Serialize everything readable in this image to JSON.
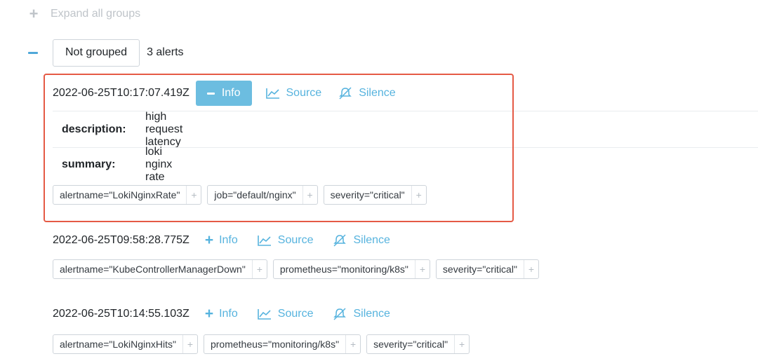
{
  "expand_all": {
    "label": "Expand all groups"
  },
  "group": {
    "name": "Not grouped",
    "count": "3 alerts"
  },
  "alerts": [
    {
      "timestamp": "2022-06-25T10:17:07.419Z",
      "info_label": "Info",
      "source_label": "Source",
      "silence_label": "Silence",
      "annotations": [
        {
          "key": "description:",
          "value": "high request latency"
        },
        {
          "key": "summary:",
          "value": "loki nginx rate"
        }
      ],
      "labels": [
        "alertname=\"LokiNginxRate\"",
        "job=\"default/nginx\"",
        "severity=\"critical\""
      ]
    },
    {
      "timestamp": "2022-06-25T09:58:28.775Z",
      "info_label": "Info",
      "source_label": "Source",
      "silence_label": "Silence",
      "labels": [
        "alertname=\"KubeControllerManagerDown\"",
        "prometheus=\"monitoring/k8s\"",
        "severity=\"critical\""
      ]
    },
    {
      "timestamp": "2022-06-25T10:14:55.103Z",
      "info_label": "Info",
      "source_label": "Source",
      "silence_label": "Silence",
      "labels": [
        "alertname=\"LokiNginxHits\"",
        "prometheus=\"monitoring/k8s\"",
        "severity=\"critical\""
      ]
    }
  ],
  "label_add_glyph": "+",
  "colors": {
    "accent": "#56b3de",
    "info_active_bg": "#6cbde0",
    "highlight": "#e55a45"
  }
}
